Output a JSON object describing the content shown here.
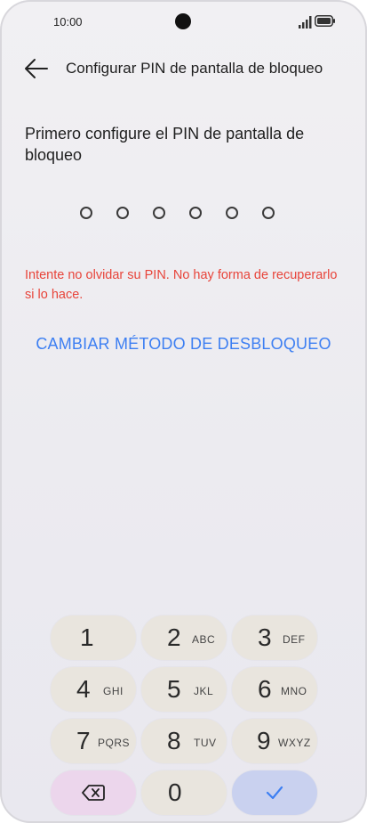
{
  "status_bar": {
    "time": "10:00",
    "icons": [
      "camera-cutout",
      "signal-icon",
      "battery-icon"
    ]
  },
  "header": {
    "title": "Configurar PIN de pantalla de bloqueo",
    "back_icon": "arrow-left-icon"
  },
  "prompt": "Primero configure el PIN de pantalla de bloqueo",
  "pin": {
    "length": 6,
    "entered": 0
  },
  "warning": "Intente no olvidar su PIN. No hay forma de recuperarlo si lo hace.",
  "change_method_label": "CAMBIAR MÉTODO DE DESBLOQUEO",
  "keypad": {
    "keys": [
      {
        "digit": "1",
        "letters": ""
      },
      {
        "digit": "2",
        "letters": "ABC"
      },
      {
        "digit": "3",
        "letters": "DEF"
      },
      {
        "digit": "4",
        "letters": "GHI"
      },
      {
        "digit": "5",
        "letters": "JKL"
      },
      {
        "digit": "6",
        "letters": "MNO"
      },
      {
        "digit": "7",
        "letters": "PQRS"
      },
      {
        "digit": "8",
        "letters": "TUV"
      },
      {
        "digit": "9",
        "letters": "WXYZ"
      },
      {
        "digit": "0",
        "letters": ""
      }
    ],
    "delete_icon": "backspace-icon",
    "confirm_icon": "checkmark-icon",
    "colors": {
      "key": "#e9e5de",
      "delete": "#ecd6ec",
      "confirm": "#c9d1ef",
      "confirm_icon": "#3d7ff2"
    }
  },
  "colors": {
    "warning": "#e8443a",
    "link": "#3d7ff2"
  }
}
